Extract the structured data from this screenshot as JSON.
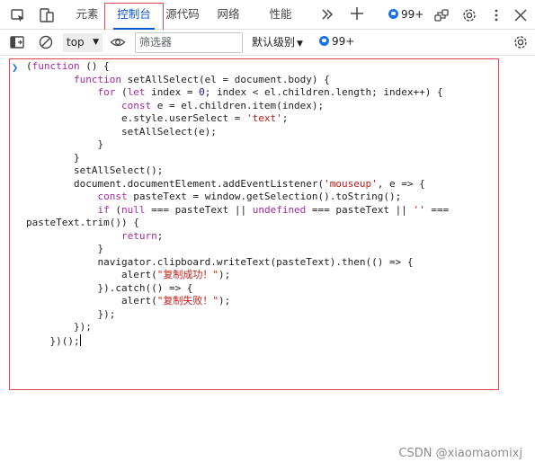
{
  "tabs": [
    {
      "label": "元素"
    },
    {
      "label": "控制台"
    },
    {
      "label": "源代码"
    },
    {
      "label": "网络"
    },
    {
      "label": "性能"
    }
  ],
  "tabbar_badge": "99+",
  "toolbar": {
    "context": "top",
    "filter_placeholder": "筛选器",
    "level": "默认级别",
    "issues_badge": "99+"
  },
  "code_lines": [
    "(function () {",
    "        function setAllSelect(el = document.body) {",
    "            for (let index = 0; index < el.children.length; index++) {",
    "                const e = el.children.item(index);",
    "                e.style.userSelect = 'text';",
    "                setAllSelect(e);",
    "            }",
    "        }",
    "        setAllSelect();",
    "        document.documentElement.addEventListener('mouseup', e => {",
    "            const pasteText = window.getSelection().toString();",
    "            if (null === pasteText || undefined === pasteText || '' ===",
    "pasteText.trim()) {",
    "                return;",
    "            }",
    "            navigator.clipboard.writeText(pasteText).then(() => {",
    "                alert(\"复制成功！\");",
    "            }).catch(() => {",
    "                alert(\"复制失败！\");",
    "            });",
    "        });",
    "    })();"
  ],
  "watermark": "CSDN @xiaomaomixj",
  "colors": {
    "accent": "#0b57d0",
    "highlight_border": "#e0474f",
    "prompt": "#1a73e8"
  }
}
